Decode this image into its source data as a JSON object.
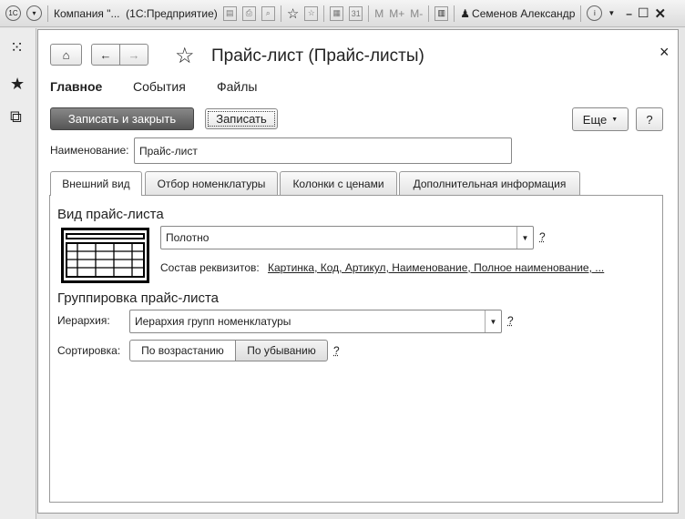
{
  "titlebar": {
    "title": "Компания \"...  (1С:Предприятие)",
    "memory_buttons": [
      "M",
      "M+",
      "M-"
    ],
    "user": "Семенов Александр"
  },
  "form": {
    "title": "Прайс-лист (Прайс-листы)",
    "close": "×",
    "nav_tabs": [
      "Главное",
      "События",
      "Файлы"
    ],
    "save_close_label": "Записать и закрыть",
    "save_label": "Записать",
    "more_label": "Еще",
    "help_label": "?",
    "name_label": "Наименование:",
    "name_value": "Прайс-лист",
    "tabs": [
      "Внешний вид",
      "Отбор номенклатуры",
      "Колонки с ценами",
      "Дополнительная информация"
    ],
    "view": {
      "heading": "Вид прайс-листа",
      "value": "Полотно",
      "help": "?",
      "attrs_label": "Состав реквизитов:",
      "attrs_value": "Картинка, Код, Артикул, Наименование, Полное наименование, ..."
    },
    "grouping": {
      "heading": "Группировка прайс-листа",
      "hierarchy_label": "Иерархия:",
      "hierarchy_value": "Иерархия групп номенклатуры",
      "help": "?",
      "sort_label": "Сортировка:",
      "sort_options": [
        "По возрастанию",
        "По убыванию"
      ],
      "sort_help": "?"
    }
  }
}
